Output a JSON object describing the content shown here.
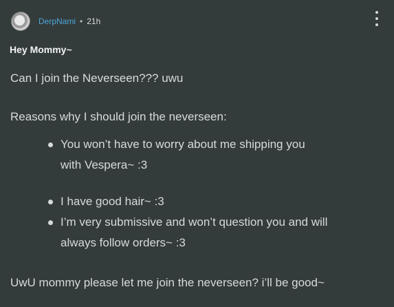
{
  "post": {
    "author": "DerpNami",
    "separator": "•",
    "time": "21h",
    "title": "Hey Mommy~",
    "paragraphs": [
      "Can I join the Neverseen??? uwu",
      "Reasons why I should join the neverseen:",
      "UwU mommy please let me join the neverseen? i’ll be good~"
    ],
    "bullets": [
      "You won’t have to worry about me shipping you",
      "with Vespera~ :3",
      "I have good hair~ :3",
      "I’m very submissive and won’t question you and will",
      "always follow orders~ :3"
    ]
  },
  "icons": {
    "menu": "more-vertical-icon",
    "avatar": "user-avatar"
  }
}
